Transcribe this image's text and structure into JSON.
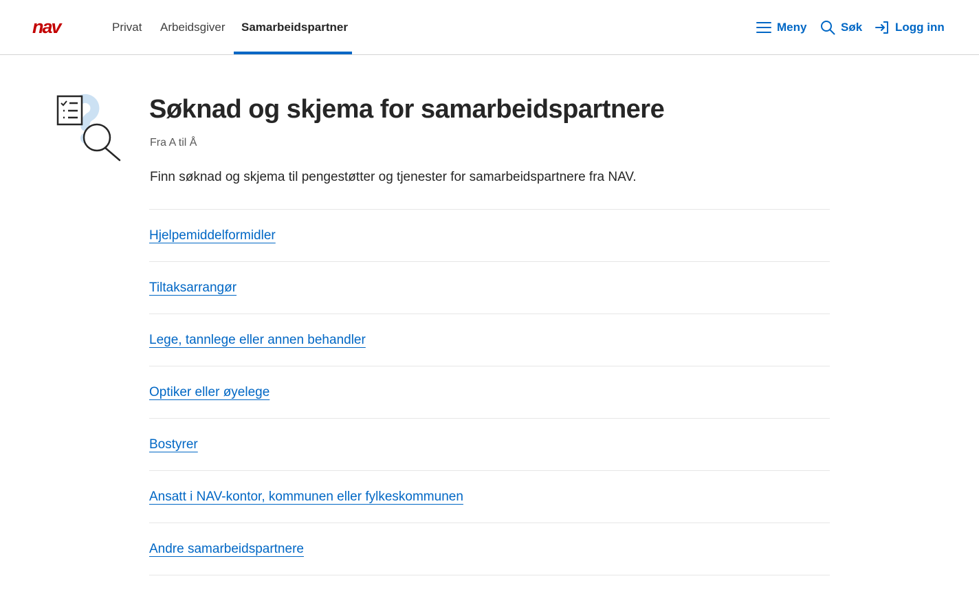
{
  "header": {
    "logo_text": "nav",
    "audience_tabs": [
      {
        "label": "Privat"
      },
      {
        "label": "Arbeidsgiver"
      },
      {
        "label": "Samarbeidspartner"
      }
    ],
    "active_tab": "Samarbeidspartner",
    "tools": {
      "menu": {
        "label": "Meny",
        "icon": "hamburger-icon"
      },
      "search": {
        "label": "Søk",
        "icon": "search-icon"
      },
      "login": {
        "label": "Logg inn",
        "icon": "login-icon"
      }
    }
  },
  "page": {
    "illustration_icon": "checklist-magnifier-illustration",
    "title": "Søknad og skjema for samarbeidspartnere",
    "subtitle": "Fra A til Å",
    "ingress": "Finn søknad og skjema til pengestøtter og tjenester for samarbeidspartnere fra NAV.",
    "links": [
      {
        "label": "Hjelpemiddelformidler"
      },
      {
        "label": "Tiltaksarrangør"
      },
      {
        "label": "Lege, tannlege eller annen behandler"
      },
      {
        "label": "Optiker eller øyelege"
      },
      {
        "label": "Bostyrer"
      },
      {
        "label": "Ansatt i NAV-kontor, kommunen eller fylkeskommunen"
      },
      {
        "label": "Andre samarbeidspartnere"
      }
    ]
  },
  "colors": {
    "brand_red": "#c30000",
    "link_blue": "#0067c5",
    "text": "#262626",
    "divider": "#e6e6e6",
    "illustration_blue": "#cce1f3"
  }
}
